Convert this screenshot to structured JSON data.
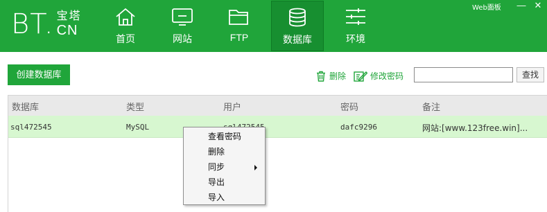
{
  "app": {
    "logo_bt": "BT.",
    "logo_top": "宝塔",
    "logo_bottom": "CN",
    "window_title": "Web面板",
    "minimize_glyph": "—",
    "close_glyph": "✕"
  },
  "nav": {
    "items": [
      {
        "label": "首页",
        "icon": "home-icon",
        "active": false
      },
      {
        "label": "网站",
        "icon": "monitor-icon",
        "active": false
      },
      {
        "label": "FTP",
        "icon": "folder-icon",
        "active": false
      },
      {
        "label": "数据库",
        "icon": "database-icon",
        "active": true
      },
      {
        "label": "环境",
        "icon": "sliders-icon",
        "active": false
      }
    ]
  },
  "toolbar": {
    "create_label": "创建数据库",
    "delete_label": "删除",
    "change_password_label": "修改密码",
    "search_value": "",
    "search_label": "查找"
  },
  "table": {
    "columns": [
      "数据库",
      "类型",
      "用户",
      "密码",
      "备注"
    ],
    "rows": [
      {
        "database": "sql472545",
        "type": "MySQL",
        "user": "sql472545",
        "password": "dafc9296",
        "note": "网站:[www.123free.win]..."
      }
    ]
  },
  "context_menu": {
    "items": [
      "查看密码",
      "删除",
      "同步",
      "导出",
      "导入"
    ]
  },
  "colors": {
    "brand_green": "#20a53a",
    "active_nav": "#178f30",
    "selected_row": "#d7f7d0"
  }
}
